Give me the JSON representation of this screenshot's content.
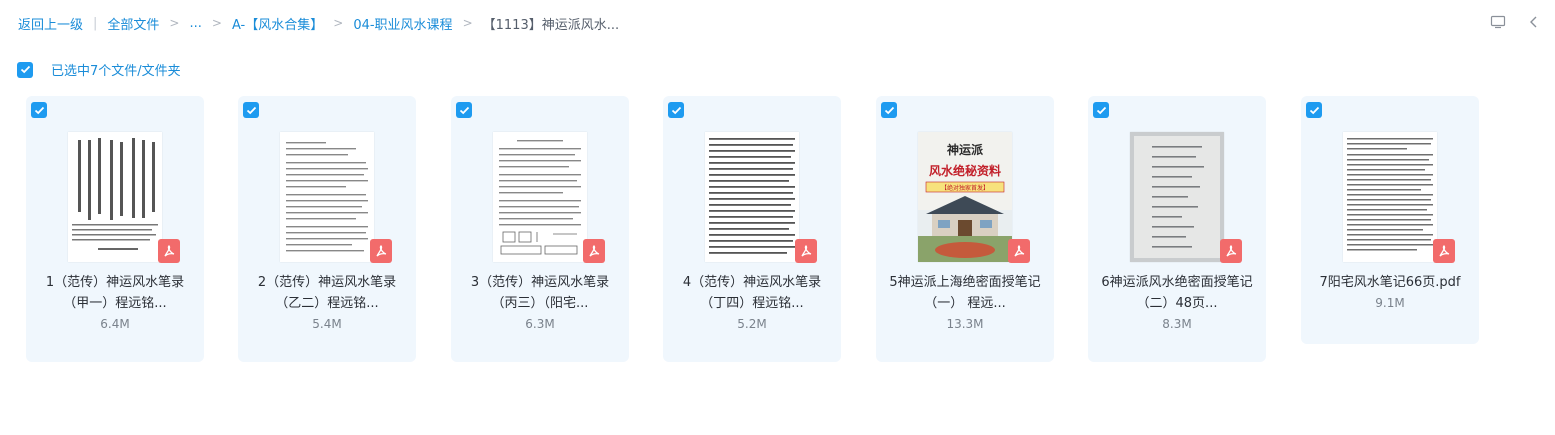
{
  "breadcrumb": {
    "back": "返回上一级",
    "sep_bar": "|",
    "all_files": "全部文件",
    "arrow": ">",
    "ellipsis": "...",
    "folder1": "A-【风水合集】",
    "folder2": "04-职业风水课程",
    "current": "【1113】神运派风水..."
  },
  "selection": {
    "text": "已选中7个文件/文件夹",
    "checked": true
  },
  "icons": {
    "view_toggle": "monitor-icon",
    "collapse": "chevron-left-icon",
    "file_type": "pdf-icon",
    "checkbox": "check-icon"
  },
  "colors": {
    "accent": "#1e9bf0",
    "link": "#1a8cd8",
    "card_bg": "#f0f7fd",
    "pdf_red": "#f26b6b"
  },
  "files": [
    {
      "name_line1": "1（范传）神运风水笔录",
      "name_line2": "（甲一）程远铭...",
      "size": "6.4M",
      "thumb": "vertical",
      "selected": true
    },
    {
      "name_line1": "2（范传）神运风水笔录",
      "name_line2": "（乙二）程远铭...",
      "size": "5.4M",
      "thumb": "text",
      "selected": true
    },
    {
      "name_line1": "3（范传）神运风水笔录",
      "name_line2": "（丙三）（阳宅...",
      "size": "6.3M",
      "thumb": "diagram",
      "selected": true
    },
    {
      "name_line1": "4（范传）神运风水笔录",
      "name_line2": "（丁四）程远铭...",
      "size": "5.2M",
      "thumb": "dense",
      "selected": true
    },
    {
      "name_line1": "5神运派上海绝密面授笔记",
      "name_line2": "（一） 程远...",
      "size": "13.3M",
      "thumb": "cover",
      "selected": true
    },
    {
      "name_line1": "6神运派风水绝密面授笔记",
      "name_line2": "（二）48页...",
      "size": "8.3M",
      "thumb": "photo",
      "selected": true
    },
    {
      "name_line1": "7阳宅风水笔记66页.pdf",
      "name_line2": "",
      "size": "9.1M",
      "thumb": "text2",
      "selected": true
    }
  ],
  "cover": {
    "title": "神运派",
    "subtitle": "风水绝秘资料",
    "band": "【绝对独家首发】"
  }
}
